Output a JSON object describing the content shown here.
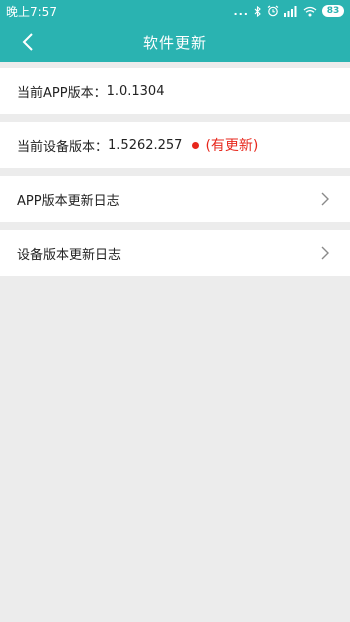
{
  "status_bar": {
    "time": "晚上7:57",
    "dots": "...",
    "battery": "83"
  },
  "header": {
    "title": "软件更新"
  },
  "rows": {
    "app_version_label": "当前APP版本：",
    "app_version_value": "1.0.1304",
    "device_version_label": "当前设备版本：",
    "device_version_value": "1.5262.257",
    "update_tag": "(有更新)",
    "app_log": "APP版本更新日志",
    "device_log": "设备版本更新日志"
  },
  "colors": {
    "accent": "#2ab3b1",
    "update_red": "#e7271c",
    "background": "#ececec"
  },
  "icons": {
    "back": "chevron-left-icon",
    "row_arrow": "chevron-right-icon"
  }
}
